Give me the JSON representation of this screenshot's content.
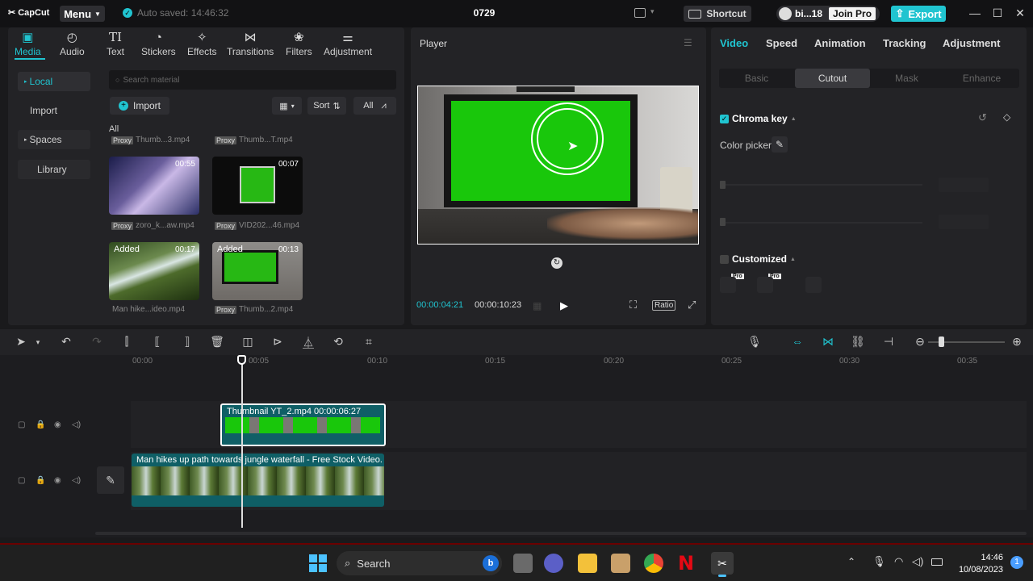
{
  "app": {
    "logo_text": "CapCut",
    "menu_label": "Menu",
    "autosave_text": "Auto saved: 14:46:32",
    "project_title": "0729",
    "shortcut_label": "Shortcut",
    "user_name": "bi...18",
    "join_pro_label": "Join Pro",
    "export_label": "Export"
  },
  "media_tabs": [
    {
      "label": "Media",
      "icon": "media-icon",
      "active": true
    },
    {
      "label": "Audio",
      "icon": "audio-icon"
    },
    {
      "label": "Text",
      "icon": "text-icon"
    },
    {
      "label": "Stickers",
      "icon": "stickers-icon"
    },
    {
      "label": "Effects",
      "icon": "effects-icon"
    },
    {
      "label": "Transitions",
      "icon": "transitions-icon"
    },
    {
      "label": "Filters",
      "icon": "filters-icon"
    },
    {
      "label": "Adjustment",
      "icon": "adjustment-icon"
    }
  ],
  "media_sidebar": {
    "local": "Local",
    "import": "Import",
    "spaces": "Spaces",
    "library": "Library"
  },
  "media": {
    "search_placeholder": "Search material",
    "import_label": "Import",
    "sort_label": "Sort",
    "filter_label": "All",
    "all_label": "All",
    "proxy_tag": "Proxy",
    "top_names": [
      "Thumb...3.mp4",
      "Thumb...T.mp4"
    ],
    "items": [
      {
        "name": "zoro_k...aw.mp4",
        "duration": "00:55",
        "proxy": true,
        "added": ""
      },
      {
        "name": "VID202...46.mp4",
        "duration": "00:07",
        "proxy": true,
        "added": ""
      },
      {
        "name": "Man hike...ideo.mp4",
        "duration": "00:17",
        "proxy": false,
        "added": "Added"
      },
      {
        "name": "Thumb...2.mp4",
        "duration": "00:13",
        "proxy": true,
        "added": "Added"
      }
    ]
  },
  "player": {
    "title": "Player",
    "current_time": "00:00:04:21",
    "total_time": "00:00:10:23",
    "ratio_label": "Ratio"
  },
  "props": {
    "tabs": [
      "Video",
      "Speed",
      "Animation",
      "Tracking",
      "Adjustment"
    ],
    "subtabs": [
      "Basic",
      "Cutout",
      "Mask",
      "Enhance"
    ],
    "chroma_key_label": "Chroma key",
    "color_picker_label": "Color picker",
    "customized_label": "Customized",
    "pro_badge": "Pro"
  },
  "timeline": {
    "ticks": [
      "00:00",
      "00:05",
      "00:10",
      "00:15",
      "00:20",
      "00:25",
      "00:30",
      "00:35"
    ],
    "clip1_label": "Thumbnail YT_2.mp4  00:00:06:27",
    "clip2_label": "Man hikes up path towards jungle waterfall - Free Stock Video."
  },
  "taskbar": {
    "search_label": "Search",
    "time": "14:46",
    "date": "10/08/2023",
    "notification_count": "1"
  },
  "colors": {
    "accent": "#20c4d0",
    "chroma_green": "#19c70b",
    "clip_teal": "#0f5f66"
  }
}
